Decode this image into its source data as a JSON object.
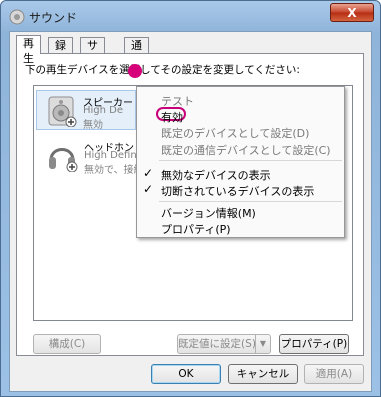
{
  "window": {
    "title": "サウンド",
    "close_label": "X"
  },
  "tabs": [
    {
      "label": "再生",
      "active": true
    },
    {
      "label": "録音",
      "active": false
    },
    {
      "label": "サウンド",
      "active": false
    },
    {
      "label": "通信",
      "active": false
    }
  ],
  "instruction": "下の再生デバイスを選択してその設定を変更してください:",
  "devices": [
    {
      "name": "スピーカー",
      "line1": "High De",
      "line2": "無効",
      "icon": "speaker-icon"
    },
    {
      "name": "ヘッドホン",
      "line1": "High Definiti",
      "line2": "無効で、接続さ",
      "icon": "headphones-icon"
    }
  ],
  "context_menu": {
    "items": [
      {
        "label": "テスト",
        "disabled": true
      },
      {
        "label": "有効",
        "disabled": false,
        "highlighted": true
      },
      {
        "label": "既定のデバイスとして設定(D)",
        "disabled": true
      },
      {
        "label": "既定の通信デバイスとして設定(C)",
        "disabled": true
      },
      {
        "label": "無効なデバイスの表示",
        "checked": true
      },
      {
        "label": "切断されているデバイスの表示",
        "checked": true
      },
      {
        "label": "バージョン情報(M)",
        "disabled": false
      },
      {
        "label": "プロパティ(P)",
        "disabled": false
      }
    ]
  },
  "panel_buttons": {
    "configure": "構成(C)",
    "set_default": "既定値に設定(S)",
    "properties": "プロパティ(P)"
  },
  "dialog_buttons": {
    "ok": "OK",
    "cancel": "キャンセル",
    "apply": "適用(A)"
  },
  "colors": {
    "accent_pink": "#d6007a",
    "close_red": "#c6432a"
  }
}
